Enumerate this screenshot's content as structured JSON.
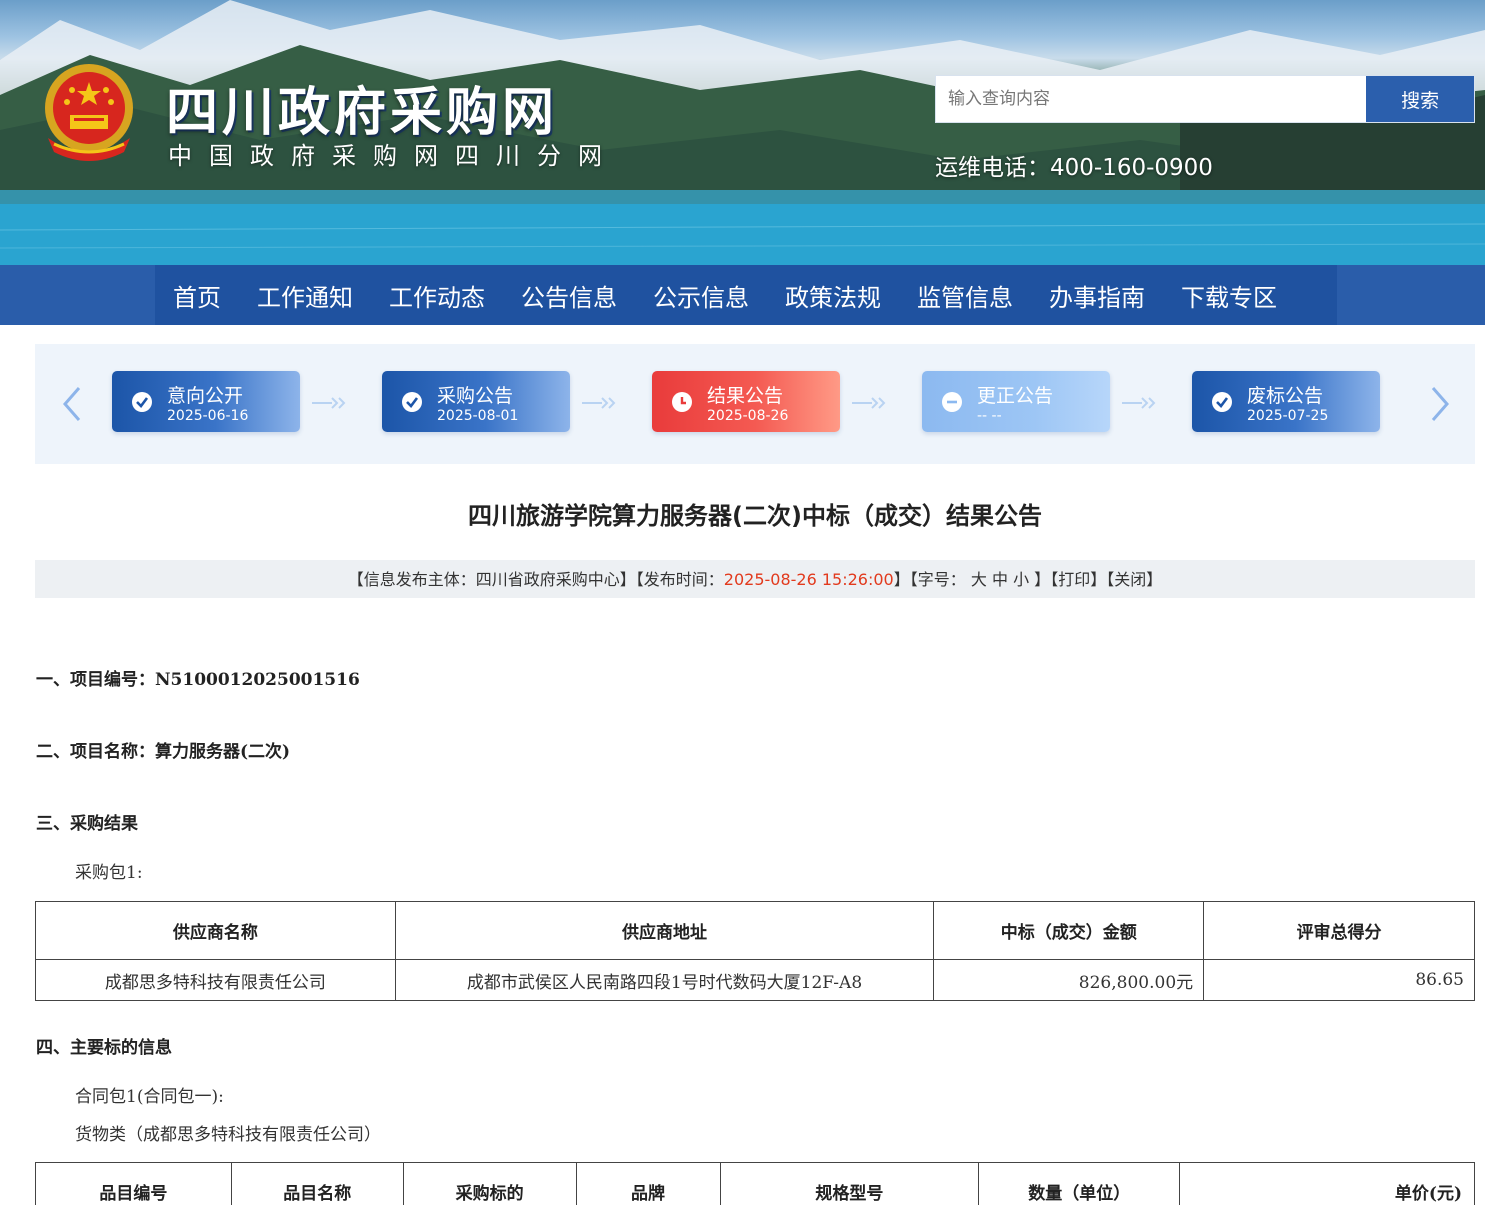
{
  "header": {
    "site_title": "四川政府采购网",
    "site_subtitle": "中国政府采购网四川分网",
    "search_placeholder": "输入查询内容",
    "search_button": "搜索",
    "hotline": "运维电话：400-160-0900"
  },
  "nav": {
    "items": [
      "首页",
      "工作通知",
      "工作动态",
      "公告信息",
      "公示信息",
      "政策法规",
      "监管信息",
      "办事指南",
      "下载专区"
    ]
  },
  "timeline": {
    "steps": [
      {
        "label": "意向公开",
        "date": "2025-06-16",
        "state": "done",
        "icon": "check-icon"
      },
      {
        "label": "采购公告",
        "date": "2025-08-01",
        "state": "done",
        "icon": "check-icon"
      },
      {
        "label": "结果公告",
        "date": "2025-08-26",
        "state": "current",
        "icon": "clock-icon"
      },
      {
        "label": "更正公告",
        "date": "-- --",
        "state": "pending",
        "icon": "minus-icon"
      },
      {
        "label": "废标公告",
        "date": "2025-07-25",
        "state": "done",
        "icon": "check-icon"
      }
    ]
  },
  "article": {
    "title": "四川旅游学院算力服务器(二次)中标（成交）结果公告",
    "meta": {
      "publisher_prefix": "【信息发布主体：四川省政府采购中心】【发布时间：",
      "publish_time": "2025-08-26 15:26:00",
      "font_prefix": "】【字号：",
      "font_sizes": [
        "大",
        "中",
        "小"
      ],
      "font_suffix": "】",
      "print": "【打印】",
      "close": "【关闭】"
    },
    "section1": "一、项目编号：N5100012025001516",
    "section2": "二、项目名称：算力服务器(二次)",
    "section3": "三、采购结果",
    "package_label": "采购包1:",
    "result_table": {
      "headers": [
        "供应商名称",
        "供应商地址",
        "中标（成交）金额",
        "评审总得分"
      ],
      "rows": [
        [
          "成都思多特科技有限责任公司",
          "成都市武侯区人民南路四段1号时代数码大厦12F-A8",
          "826,800.00元",
          "86.65"
        ]
      ]
    },
    "section4": "四、主要标的信息",
    "contract_label": "合同包1(合同包一):",
    "goods_label": "货物类（成都思多特科技有限责任公司）",
    "goods_table": {
      "headers": [
        "品目编号",
        "品目名称",
        "采购标的",
        "品牌",
        "规格型号",
        "数量（单位）",
        "单价(元)"
      ]
    }
  },
  "colors": {
    "nav_bg": "#2a5daa",
    "step_done": "#1c55a8",
    "step_current": "#e93b3b",
    "step_pending": "#8cb9f0",
    "publish_time": "#e23a1d"
  }
}
